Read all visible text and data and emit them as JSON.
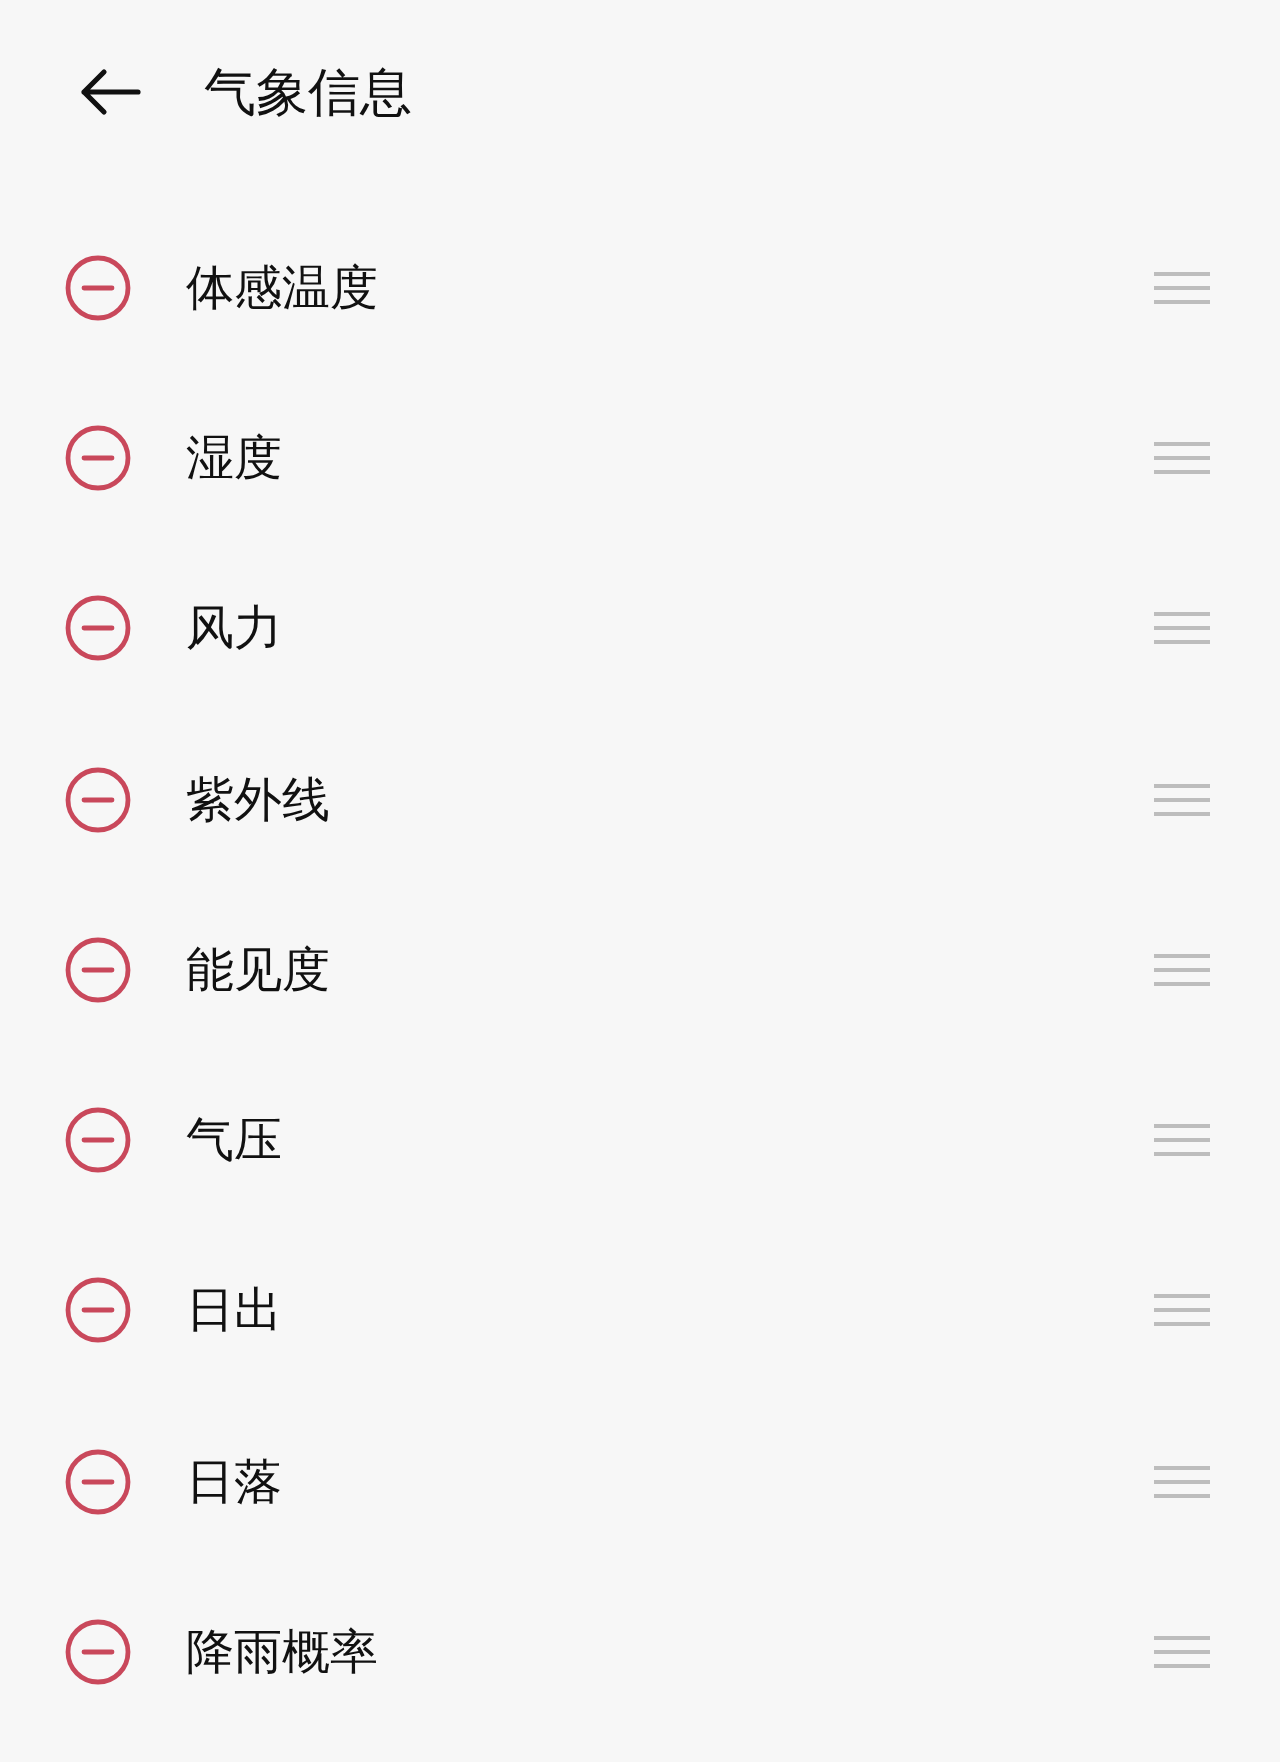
{
  "header": {
    "title": "气象信息"
  },
  "items": [
    {
      "label": "体感温度"
    },
    {
      "label": "湿度"
    },
    {
      "label": "风力"
    },
    {
      "label": "紫外线"
    },
    {
      "label": "能见度"
    },
    {
      "label": "气压"
    },
    {
      "label": "日出"
    },
    {
      "label": "日落"
    },
    {
      "label": "降雨概率"
    }
  ]
}
